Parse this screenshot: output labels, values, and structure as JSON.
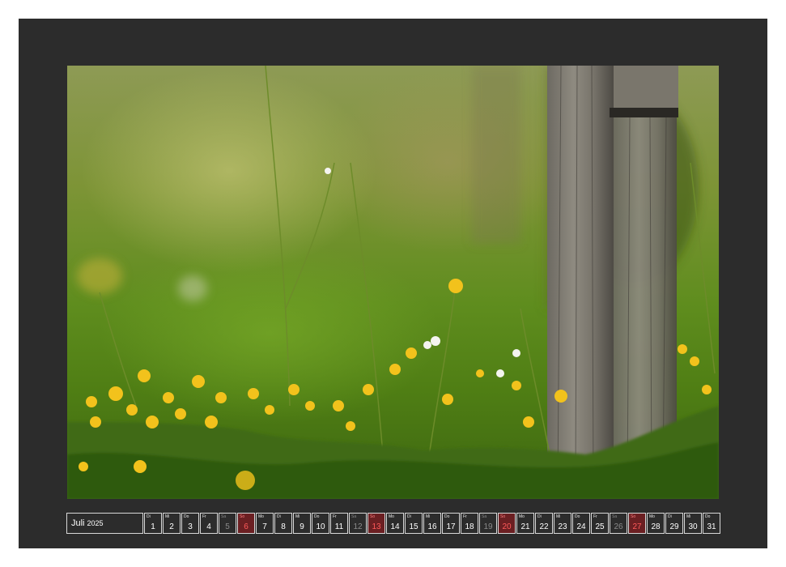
{
  "calendar": {
    "month": "Juli",
    "year": "2025",
    "days": [
      {
        "wd": "Di",
        "num": "1",
        "type": "weekday"
      },
      {
        "wd": "Mi",
        "num": "2",
        "type": "weekday"
      },
      {
        "wd": "Do",
        "num": "3",
        "type": "weekday"
      },
      {
        "wd": "Fr",
        "num": "4",
        "type": "weekday"
      },
      {
        "wd": "Sa",
        "num": "5",
        "type": "sat"
      },
      {
        "wd": "So",
        "num": "6",
        "type": "sun"
      },
      {
        "wd": "Mo",
        "num": "7",
        "type": "weekday"
      },
      {
        "wd": "Di",
        "num": "8",
        "type": "weekday"
      },
      {
        "wd": "Mi",
        "num": "9",
        "type": "weekday"
      },
      {
        "wd": "Do",
        "num": "10",
        "type": "weekday"
      },
      {
        "wd": "Fr",
        "num": "11",
        "type": "weekday"
      },
      {
        "wd": "Sa",
        "num": "12",
        "type": "sat"
      },
      {
        "wd": "So",
        "num": "13",
        "type": "sun"
      },
      {
        "wd": "Mo",
        "num": "14",
        "type": "weekday"
      },
      {
        "wd": "Di",
        "num": "15",
        "type": "weekday"
      },
      {
        "wd": "Mi",
        "num": "16",
        "type": "weekday"
      },
      {
        "wd": "Do",
        "num": "17",
        "type": "weekday"
      },
      {
        "wd": "Fr",
        "num": "18",
        "type": "weekday"
      },
      {
        "wd": "Sa",
        "num": "19",
        "type": "sat"
      },
      {
        "wd": "So",
        "num": "20",
        "type": "sun"
      },
      {
        "wd": "Mo",
        "num": "21",
        "type": "weekday"
      },
      {
        "wd": "Di",
        "num": "22",
        "type": "weekday"
      },
      {
        "wd": "Mi",
        "num": "23",
        "type": "weekday"
      },
      {
        "wd": "Do",
        "num": "24",
        "type": "weekday"
      },
      {
        "wd": "Fr",
        "num": "25",
        "type": "weekday"
      },
      {
        "wd": "Sa",
        "num": "26",
        "type": "sat"
      },
      {
        "wd": "So",
        "num": "27",
        "type": "sun"
      },
      {
        "wd": "Mo",
        "num": "28",
        "type": "weekday"
      },
      {
        "wd": "Di",
        "num": "29",
        "type": "weekday"
      },
      {
        "wd": "Mi",
        "num": "30",
        "type": "weekday"
      },
      {
        "wd": "Do",
        "num": "31",
        "type": "weekday"
      }
    ]
  },
  "colors": {
    "sheet": "#2c2c2c",
    "sunday_text": "#ff5a5a",
    "sunday_bg": "#6b1f22",
    "saturday_text": "#8a8a8a"
  }
}
